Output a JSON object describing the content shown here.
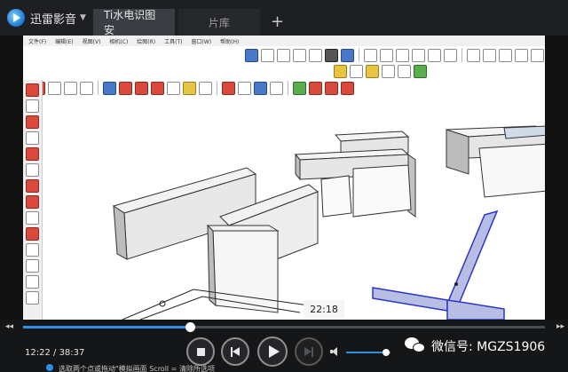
{
  "player": {
    "app_name": "迅雷影音",
    "tabs": [
      {
        "label": "Ti水电识图安"
      },
      {
        "label": "片库"
      }
    ],
    "add_tab_label": "+",
    "current_time": "12:22",
    "total_time": "38:37",
    "time_separator": " / ",
    "hover_time": "22:18",
    "seek_left_arrow": "◂◂",
    "seek_right_arrow": "▸▸",
    "progress_fraction": 0.32,
    "volume_fraction": 0.9,
    "accent_color": "#2e8fe6"
  },
  "watermark": {
    "text": "微信号: MGZS1906"
  },
  "subtitle_text": "选取两个点或拖动\"模拟画面   Scroll = 清除所选项",
  "sketchup": {
    "menu_items": [
      "文件(F)",
      "编辑(E)",
      "视图(V)",
      "相机(C)",
      "绘图(R)",
      "工具(T)",
      "窗口(W)",
      "帮助(H)"
    ]
  }
}
